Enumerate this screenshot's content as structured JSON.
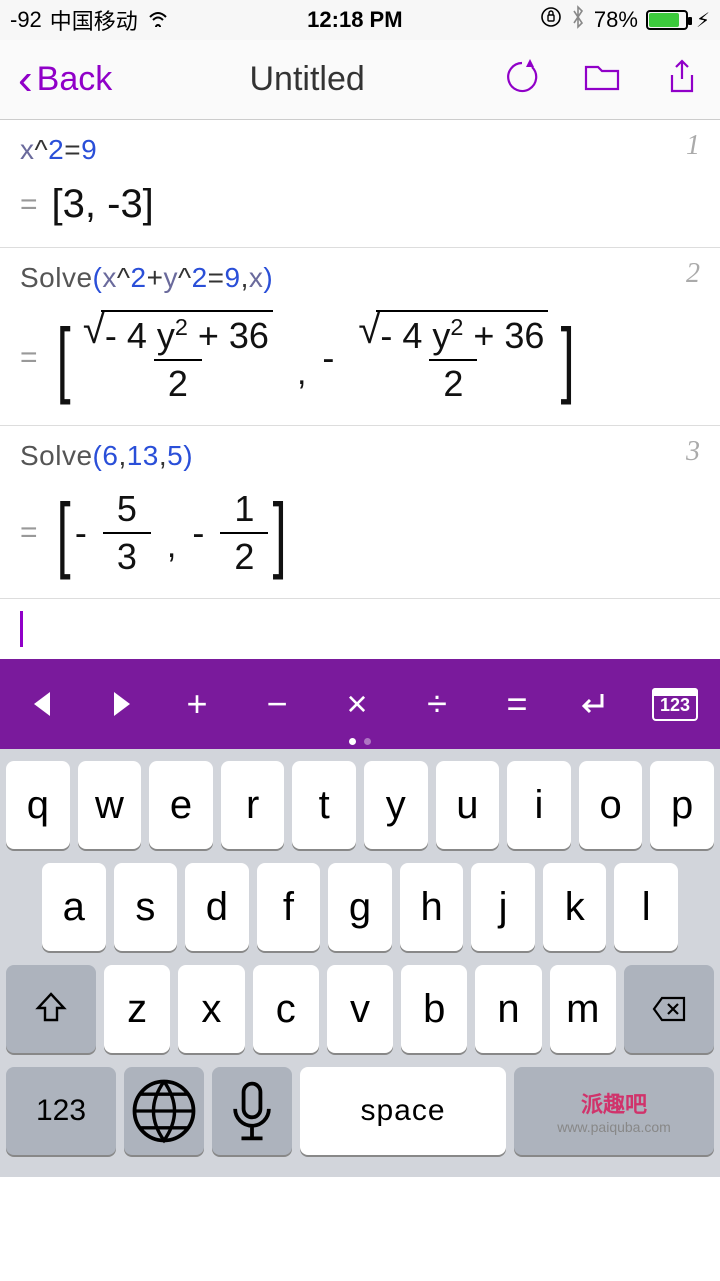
{
  "status": {
    "signal": "-92",
    "carrier": "中国移动",
    "time": "12:18 PM",
    "battery_pct": "78%"
  },
  "nav": {
    "back": "Back",
    "title": "Untitled"
  },
  "cells": [
    {
      "n": "1",
      "expr_html": "<span class='id'>x</span><span class='op'>^</span><span class='num'>2</span><span class='op'>=</span><span class='num'>9</span>",
      "result": "[3, -3]"
    },
    {
      "n": "2",
      "expr_html": "<span class='fn'>Solve</span><span class='paren'>(</span><span class='id'>x</span><span class='op'>^</span><span class='num'>2</span><span class='op'>+</span><span class='id'>y</span><span class='op'>^</span><span class='num'>2</span><span class='op'>=</span><span class='num'>9</span><span class='op'>,</span><span class='id'>x</span><span class='paren'>)</span>",
      "frac_num": "- 4 y<sup>2</sup> + 36",
      "frac_den": "2"
    },
    {
      "n": "3",
      "expr_html": "<span class='fn'>Solve</span><span class='paren'>(</span><span class='num'>6</span><span class='op'>,</span><span class='num'>13</span><span class='op'>,</span><span class='num'>5</span><span class='paren'>)</span>",
      "f1n": "5",
      "f1d": "3",
      "f2n": "1",
      "f2d": "2"
    }
  ],
  "mathbar": [
    "+",
    "−",
    "×",
    "÷",
    "="
  ],
  "kbd": {
    "row1": [
      "q",
      "w",
      "e",
      "r",
      "t",
      "y",
      "u",
      "i",
      "o",
      "p"
    ],
    "row2": [
      "a",
      "s",
      "d",
      "f",
      "g",
      "h",
      "j",
      "k",
      "l"
    ],
    "row3": [
      "z",
      "x",
      "c",
      "v",
      "b",
      "n",
      "m"
    ],
    "num": "123",
    "space": "space"
  },
  "watermark": {
    "brand": "派趣吧",
    "url": "www.paiquba.com"
  }
}
